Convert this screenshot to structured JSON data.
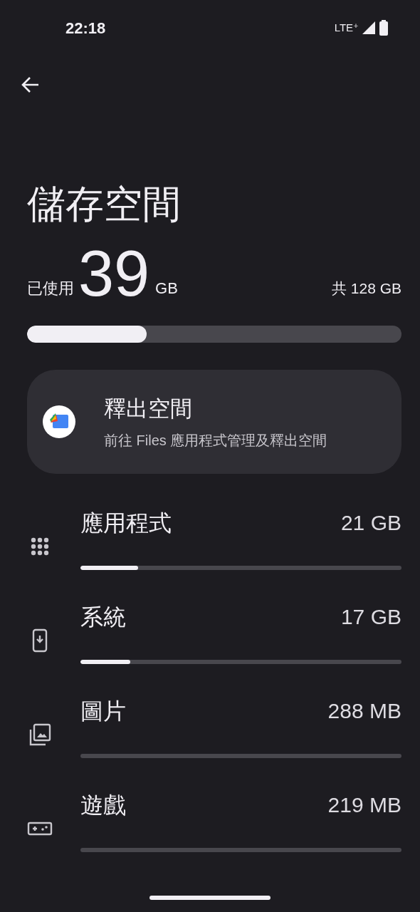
{
  "status_bar": {
    "time": "22:18",
    "network": "LTE⁺"
  },
  "title": "儲存空間",
  "usage": {
    "used_label": "已使用",
    "used_value": "39",
    "used_unit": "GB",
    "total": "共 128 GB",
    "level": 0.32
  },
  "free_up_card": {
    "title": "釋出空間",
    "subtitle": "前往 Files 應用程式管理及釋出空間"
  },
  "categories": [
    {
      "kind": "apps",
      "label": "應用程式",
      "size": "21 GB",
      "level": 0.18
    },
    {
      "kind": "system",
      "label": "系統",
      "size": "17 GB",
      "level": 0.155
    },
    {
      "kind": "images",
      "label": "圖片",
      "size": "288 MB",
      "level": 0.0
    },
    {
      "kind": "games",
      "label": "遊戲",
      "size": "219 MB",
      "level": 0.0
    }
  ]
}
